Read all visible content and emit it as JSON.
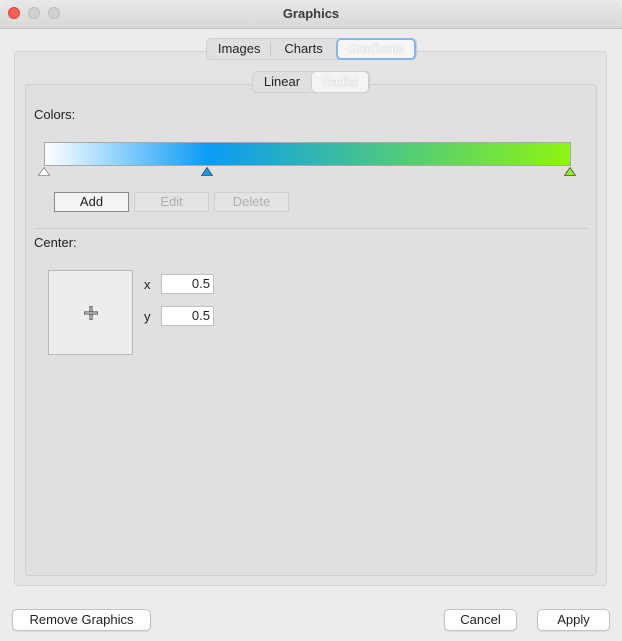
{
  "window": {
    "title": "Graphics"
  },
  "main_tabs": [
    {
      "label": "Images"
    },
    {
      "label": "Charts"
    },
    {
      "label": "Gradients",
      "selected": true
    }
  ],
  "gradient_tabs": [
    {
      "label": "Linear"
    },
    {
      "label": "Radial",
      "selected": true
    }
  ],
  "colors": {
    "label": "Colors:",
    "gradient": [
      "#ffffff",
      "#0a9bf5",
      "#8ef412"
    ],
    "stops": [
      {
        "position": 0.0,
        "color": "#ffffff"
      },
      {
        "position": 0.31,
        "color": "#0a9bf5"
      },
      {
        "position": 1.0,
        "color": "#8ef412"
      }
    ],
    "buttons": {
      "add": "Add",
      "edit": "Edit",
      "delete": "Delete"
    }
  },
  "center": {
    "label": "Center:",
    "x_label": "x",
    "x_value": "0.5",
    "y_label": "y",
    "y_value": "0.5"
  },
  "footer": {
    "remove": "Remove Graphics",
    "cancel": "Cancel",
    "apply": "Apply"
  }
}
